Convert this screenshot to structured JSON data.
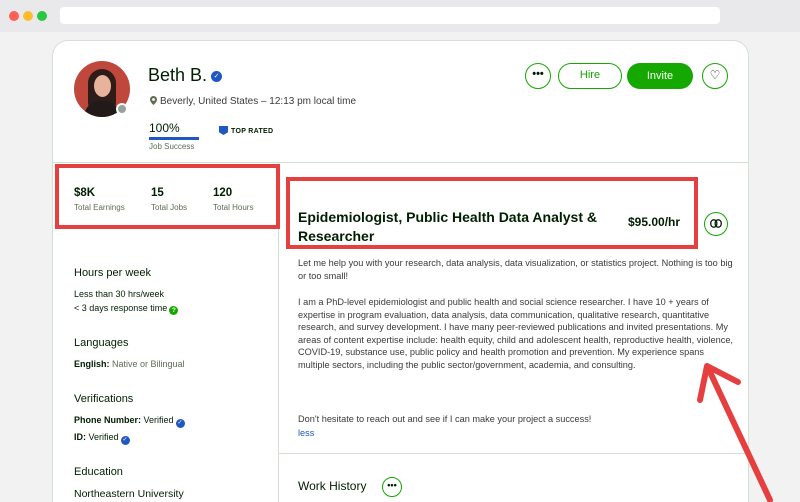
{
  "profile": {
    "name": "Beth B.",
    "location": "Beverly, United States – 12:13 pm local time",
    "job_success_value": "100%",
    "job_success_label": "Job Success",
    "top_rated": "TOP RATED"
  },
  "actions": {
    "more": "•••",
    "hire": "Hire",
    "invite": "Invite",
    "favorite": "♡"
  },
  "stats": [
    {
      "value": "$8K",
      "label": "Total Earnings"
    },
    {
      "value": "15",
      "label": "Total Jobs"
    },
    {
      "value": "120",
      "label": "Total Hours"
    }
  ],
  "sidebar": {
    "hours_heading": "Hours per week",
    "hours_value": "Less than 30 hrs/week",
    "response_time": "< 3 days response time",
    "languages_heading": "Languages",
    "language_name": "English:",
    "language_level": "Native or Bilingual",
    "verifications_heading": "Verifications",
    "phone_label": "Phone Number:",
    "phone_value": "Verified",
    "id_label": "ID:",
    "id_value": "Verified",
    "education_heading": "Education",
    "school": "Northeastern University"
  },
  "main": {
    "title": "Epidemiologist, Public Health Data Analyst & Researcher",
    "rate": "$95.00/hr",
    "desc_1": "Let me help you with your research, data analysis, data visualization, or statistics project. Nothing is too big or too small!",
    "desc_2": "I am a PhD-level epidemiologist and public health and social science researcher. I have 10 + years of expertise in program evaluation, data analysis, data communication, qualitative research, quantitative research, and survey development. I have many peer-reviewed publications and invited presentations. My areas of content expertise include: health equity, child and adolescent health, reproductive health, violence, COVID-19, substance use, public policy and health promotion and prevention. My experience spans multiple sectors, including the public sector/government, academia, and consulting.",
    "desc_3": "Don't hesitate to reach out and see if I can make your project a success!",
    "less": "less",
    "work_history": "Work History",
    "work_history_more": "•••"
  },
  "colors": {
    "brand_green": "#14a800",
    "verified_blue": "#1f57c3",
    "annotation_red": "#e63f3f"
  }
}
